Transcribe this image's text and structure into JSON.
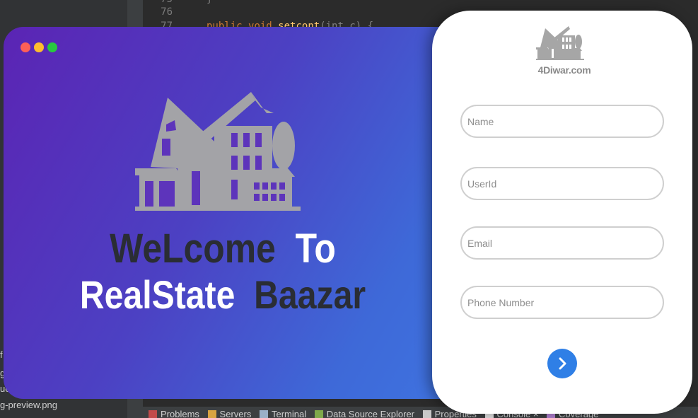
{
  "ide": {
    "line_numbers": [
      "75",
      "76",
      "77"
    ],
    "code_line_77": {
      "keyword1": "public",
      "keyword2": "void",
      "method": "setcont",
      "params": "(int c) {"
    },
    "left_panel_fragments": [
      "f",
      "g",
      "ue",
      "g-preview.png"
    ],
    "bottom_tabs": [
      "Problems",
      "Servers",
      "Terminal",
      "Data Source Explorer",
      "Properties",
      "Console",
      "Coverage"
    ]
  },
  "splash": {
    "welcome_word1": "WeLcome",
    "welcome_word2": "To",
    "brand_word1": "RealState",
    "brand_word2": "Baazar"
  },
  "form": {
    "brand": "4Diwar.com",
    "name_placeholder": "Name",
    "userid_placeholder": "UserId",
    "email_placeholder": "Email",
    "phone_placeholder": "Phone Number",
    "submit_icon": "chevron-right-icon"
  },
  "colors": {
    "gradient_start": "#5b24b4",
    "gradient_end": "#3f73e0",
    "accent": "#2f7fe6",
    "text_dark": "#2a2d34"
  }
}
